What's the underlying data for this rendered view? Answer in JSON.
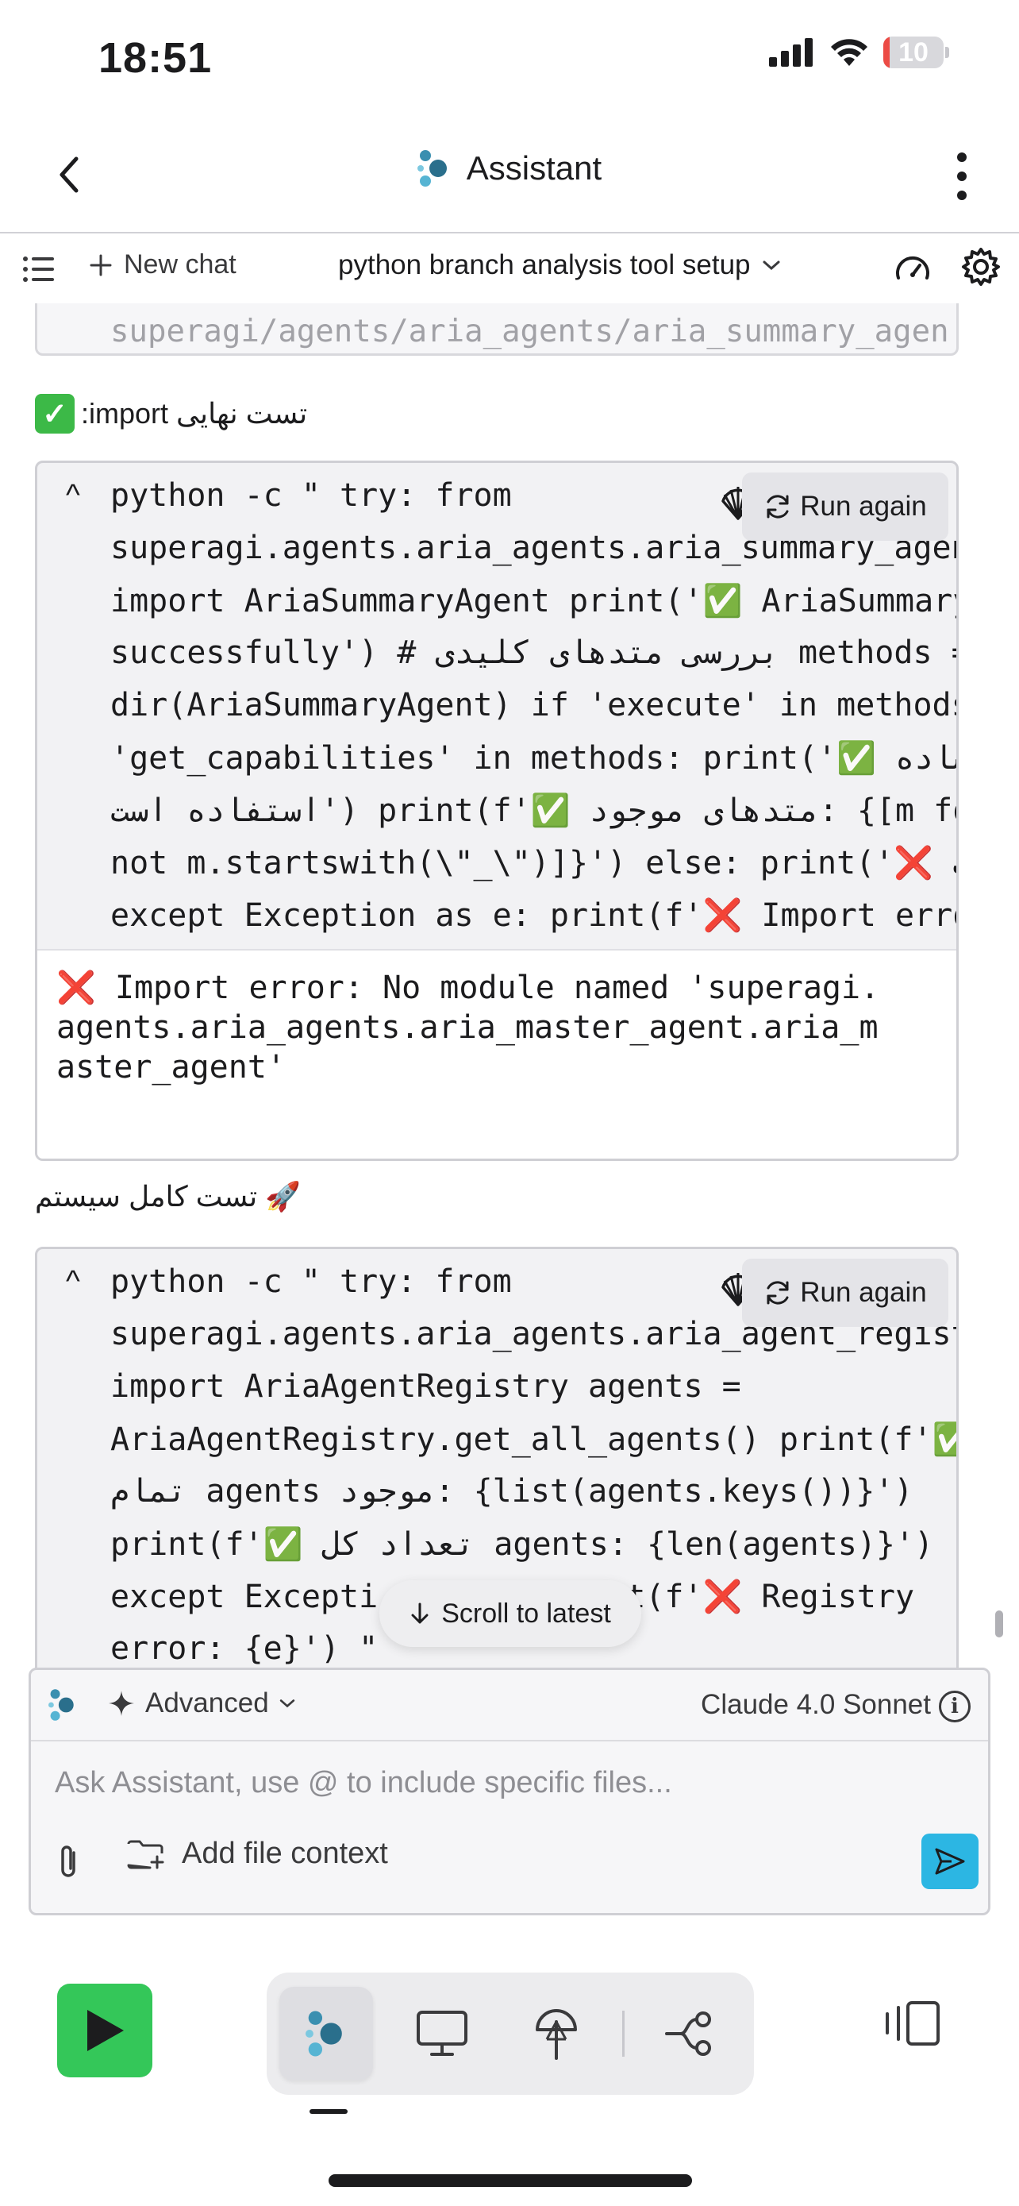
{
  "status_bar": {
    "time": "18:51",
    "battery_level": "10"
  },
  "nav": {
    "title": "Assistant"
  },
  "toolbar": {
    "new_chat_label": "New chat",
    "chat_title": "python branch analysis tool setup"
  },
  "previous_code": {
    "line": "superagi/agents/aria_agents/aria_summary_agen"
  },
  "section1": {
    "label_text": "تست نهایی import:",
    "run_again_label": "Run again",
    "code_lines": [
      "python -c \" try: from",
      "superagi.agents.aria_agents.aria_summary_agen",
      "import AriaSummaryAgent print('✅ AriaSummary",
      "successfully') # بررسی متدهای کلیدی methods =",
      "dir(AriaSummaryAgent) if 'execute' in methods",
      "'get_capabilities' in methods: print('✅ ساده",
      "استفاده است') print(f'✅ متدهای موجود: {[m fo",
      "not m.startswith(\\\"_\\\")]}') else: print('❌ ت",
      "except Exception as e: print(f'❌ Import erro"
    ],
    "output_lines": [
      "❌ Import error: No module named 'superagi.",
      "agents.aria_agents.aria_master_agent.aria_m",
      "aster_agent'"
    ]
  },
  "section2": {
    "label_text": "🚀 تست کامل سیستم",
    "run_again_label": "Run again",
    "code_lines": [
      "python -c \" try: from",
      "superagi.agents.aria_agents.aria_agent_regist",
      "import AriaAgentRegistry agents =",
      "AriaAgentRegistry.get_all_agents() print(f'✅",
      "تمام agents موجود: {list(agents.keys())}')",
      "print(f'✅ تعداد کل agents: {len(agents)}')",
      "except Excepti            nt(f'❌ Registry",
      "error: {e}') \""
    ]
  },
  "scroll_to_latest_label": "Scroll to latest",
  "composer": {
    "mode_label": "Advanced",
    "model_name": "Claude 4.0 Sonnet",
    "input_placeholder": "Ask Assistant, use @ to include specific files...",
    "input_value": "",
    "file_context_label": "Add file context"
  },
  "colors": {
    "accent": "#2cb6e3",
    "run": "#34c759",
    "error": "#e0262b",
    "success": "#3cb947"
  },
  "icons": [
    "back-icon",
    "assistant-logo-icon",
    "more-icon",
    "list-icon",
    "plus-icon",
    "chevron-down-icon",
    "gauge-icon",
    "gear-icon",
    "chevron-up-icon",
    "shell-icon",
    "refresh-icon",
    "arrow-down-icon",
    "sparkle-icon",
    "info-icon",
    "paperclip-icon",
    "folder-plus-icon",
    "send-icon",
    "play-icon",
    "monitor-icon",
    "antenna-icon",
    "flow-icon",
    "layout-icon"
  ]
}
